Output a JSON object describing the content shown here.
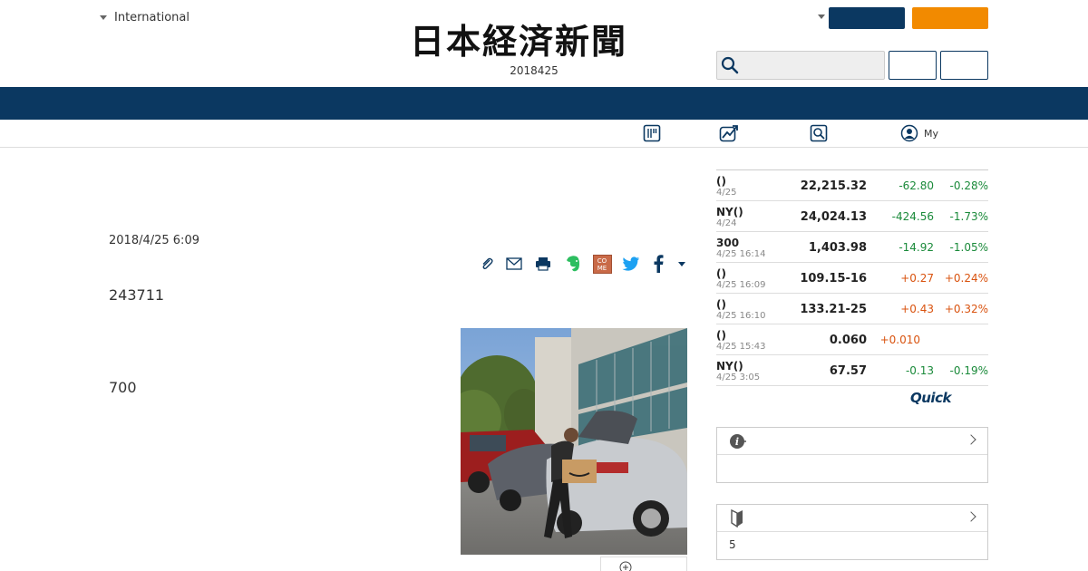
{
  "header": {
    "edition_label": "International",
    "logo_text": "日本経済新聞",
    "date": "2018425",
    "search": {
      "placeholder": ""
    },
    "colors": {
      "navy": "#0b3861",
      "orange": "#f28a00"
    }
  },
  "subnav": {
    "items": [
      {
        "icon": "newspaper-icon",
        "label": ""
      },
      {
        "icon": "chart-trend-icon",
        "label": ""
      },
      {
        "icon": "search-news-icon",
        "label": ""
      },
      {
        "icon": "user-icon",
        "label": "My"
      }
    ]
  },
  "article": {
    "pubdate": "2018/4/25 6:09",
    "lead": "243711",
    "paragraph": "700",
    "share_icons": [
      "clip-icon",
      "mail-icon",
      "print-icon",
      "evernote-icon",
      "comemo-icon",
      "twitter-icon",
      "facebook-icon",
      "more-caret-icon"
    ],
    "comemo_label": "CO ME"
  },
  "markets": {
    "rows": [
      {
        "name": "()",
        "time": "4/25",
        "value": "22,215.32",
        "change": "-62.80",
        "pct": "-0.28%",
        "dir": "neg"
      },
      {
        "name": "NY()",
        "time": "4/24",
        "value": "24,024.13",
        "change": "-424.56",
        "pct": "-1.73%",
        "dir": "neg"
      },
      {
        "name": "300",
        "time": "4/25 16:14",
        "value": "1,403.98",
        "change": "-14.92",
        "pct": "-1.05%",
        "dir": "neg"
      },
      {
        "name": "()",
        "time": "4/25 16:09",
        "value": "109.15-16",
        "change": "+0.27",
        "pct": "+0.24%",
        "dir": "pos"
      },
      {
        "name": "()",
        "time": "4/25 16:10",
        "value": "133.21-25",
        "change": "+0.43",
        "pct": "+0.32%",
        "dir": "pos"
      },
      {
        "name": "()",
        "time": "4/25 15:43",
        "value": "0.060",
        "change": "+0.010",
        "pct": "",
        "dir": "pos"
      },
      {
        "name": "NY()",
        "time": "4/25 3:05",
        "value": "67.57",
        "change": "-0.13",
        "pct": "-0.19%",
        "dir": "neg"
      }
    ],
    "provider": "Quick"
  },
  "panels": [
    {
      "icon": "info-icon",
      "title": "",
      "body": ""
    },
    {
      "icon": "beginner-mark-icon",
      "title": "",
      "body": "5"
    }
  ]
}
